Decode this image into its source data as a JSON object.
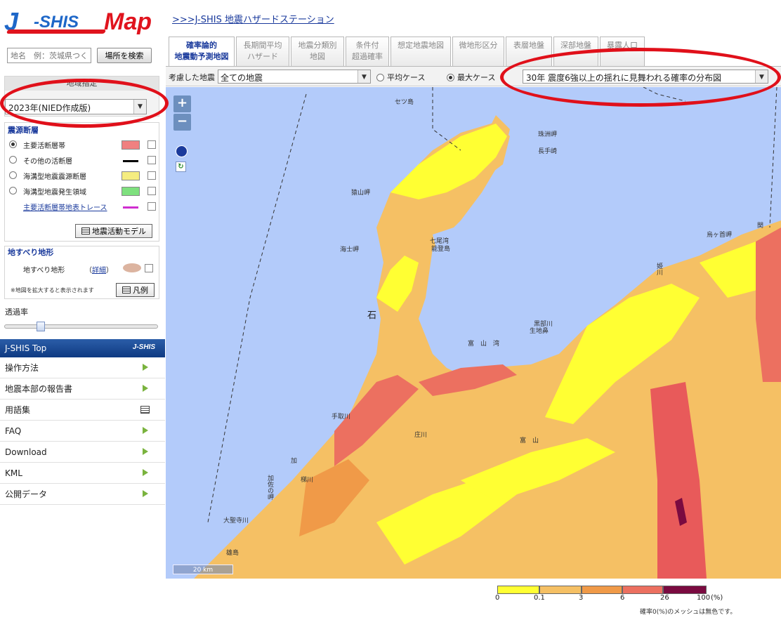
{
  "header": {
    "logo_j": "J",
    "logo_shis": "-SHIS",
    "logo_map": "Map",
    "station_link": ">>>J-SHIS 地震ハザードステーション"
  },
  "search": {
    "placeholder": "地名　例：茨城県つくば市",
    "button": "場所を検索"
  },
  "region": {
    "header": "地域指定",
    "selected_version": "2023年(NIED作成版)"
  },
  "sources": {
    "header": "震源断層",
    "items": [
      {
        "label": "主要活断層帯",
        "selected": true,
        "color": "#f08080"
      },
      {
        "label": "その他の活断層",
        "selected": false,
        "color": "#000000"
      },
      {
        "label": "海溝型地震震源断層",
        "selected": false,
        "color": "#f5ed80"
      },
      {
        "label": "海溝型地震発生領域",
        "selected": false,
        "color": "#7ee07e"
      },
      {
        "label": "主要活断層帯地表トレース",
        "selected": false,
        "color": "#d02ed0"
      }
    ],
    "model_button": "地震活動モデル"
  },
  "landslide": {
    "header": "地すべり地形",
    "label": "地すべり地形",
    "detail_open": "（",
    "detail_link": "詳細",
    "detail_close": "）",
    "note": "※地図を拡大すると表示されます",
    "legend_button": "凡例"
  },
  "opacity": {
    "label": "透過率",
    "value_fraction": 0.22
  },
  "nav": {
    "header": "J-SHIS Top",
    "header_mini": "J-SHIS",
    "items": [
      {
        "label": "操作方法",
        "icon": "arrow-right-icon"
      },
      {
        "label": "地震本部の報告書",
        "icon": "arrow-right-icon"
      },
      {
        "label": "用語集",
        "icon": "document-icon"
      },
      {
        "label": "FAQ",
        "icon": "arrow-right-icon"
      },
      {
        "label": "Download",
        "icon": "arrow-right-icon"
      },
      {
        "label": "KML",
        "icon": "arrow-right-icon"
      },
      {
        "label": "公開データ",
        "icon": "arrow-right-icon"
      }
    ]
  },
  "tabs": [
    {
      "line1": "確率論的",
      "line2": "地震動予測地図",
      "active": true
    },
    {
      "line1": "長期間平均",
      "line2": "ハザード",
      "active": false
    },
    {
      "line1": "地震分類別",
      "line2": "地図",
      "active": false
    },
    {
      "line1": "条件付",
      "line2": "超過確率",
      "active": false
    },
    {
      "line1": "想定地震地図",
      "line2": "",
      "active": false
    },
    {
      "line1": "微地形区分",
      "line2": "",
      "active": false
    },
    {
      "line1": "表層地盤",
      "line2": "",
      "active": false
    },
    {
      "line1": "深部地盤",
      "line2": "",
      "active": false
    },
    {
      "line1": "暴露人口",
      "line2": "",
      "active": false
    }
  ],
  "toolbar": {
    "considered_label": "考慮した地震",
    "earthquake_select": "全ての地震",
    "average_case": "平均ケース",
    "max_case": "最大ケース",
    "selected_case": "max",
    "map_select": "30年 震度6強以上の揺れに見舞われる確率の分布図"
  },
  "map": {
    "zoom_in": "+",
    "zoom_out": "−",
    "scale": "20 km",
    "places": {
      "setsu": "セツ島",
      "suzu": "珠洲岬",
      "nagate": "長手崎",
      "sarayama": "猿山岬",
      "kaishi": "海士岬",
      "nanao": "七尾湾",
      "noto_island": "能登島",
      "karasu": "烏ヶ首岬",
      "seki": "関",
      "ishi": "石",
      "kurobe": "黒部川",
      "ikuji": "生地鼻",
      "toyama": "富　山　湾",
      "kagaya": "加",
      "tedori": "手取川",
      "kakehashi": "梯川",
      "kano": "加佐の岬",
      "daishoji": "大聖寺川",
      "yuzaki": "雄島",
      "tomiyama": "富　山",
      "himekawa": "姫川",
      "oyabe": "庄川"
    }
  },
  "legend": {
    "ticks": [
      "0",
      "0.1",
      "3",
      "6",
      "26",
      "100"
    ],
    "unit": "(%)",
    "colors": [
      "#ffff33",
      "#f5c064",
      "#f09a48",
      "#ec7060",
      "#e85a5a",
      "#7a0a40"
    ],
    "note": "確率0(%)のメッシュは無色です。"
  }
}
